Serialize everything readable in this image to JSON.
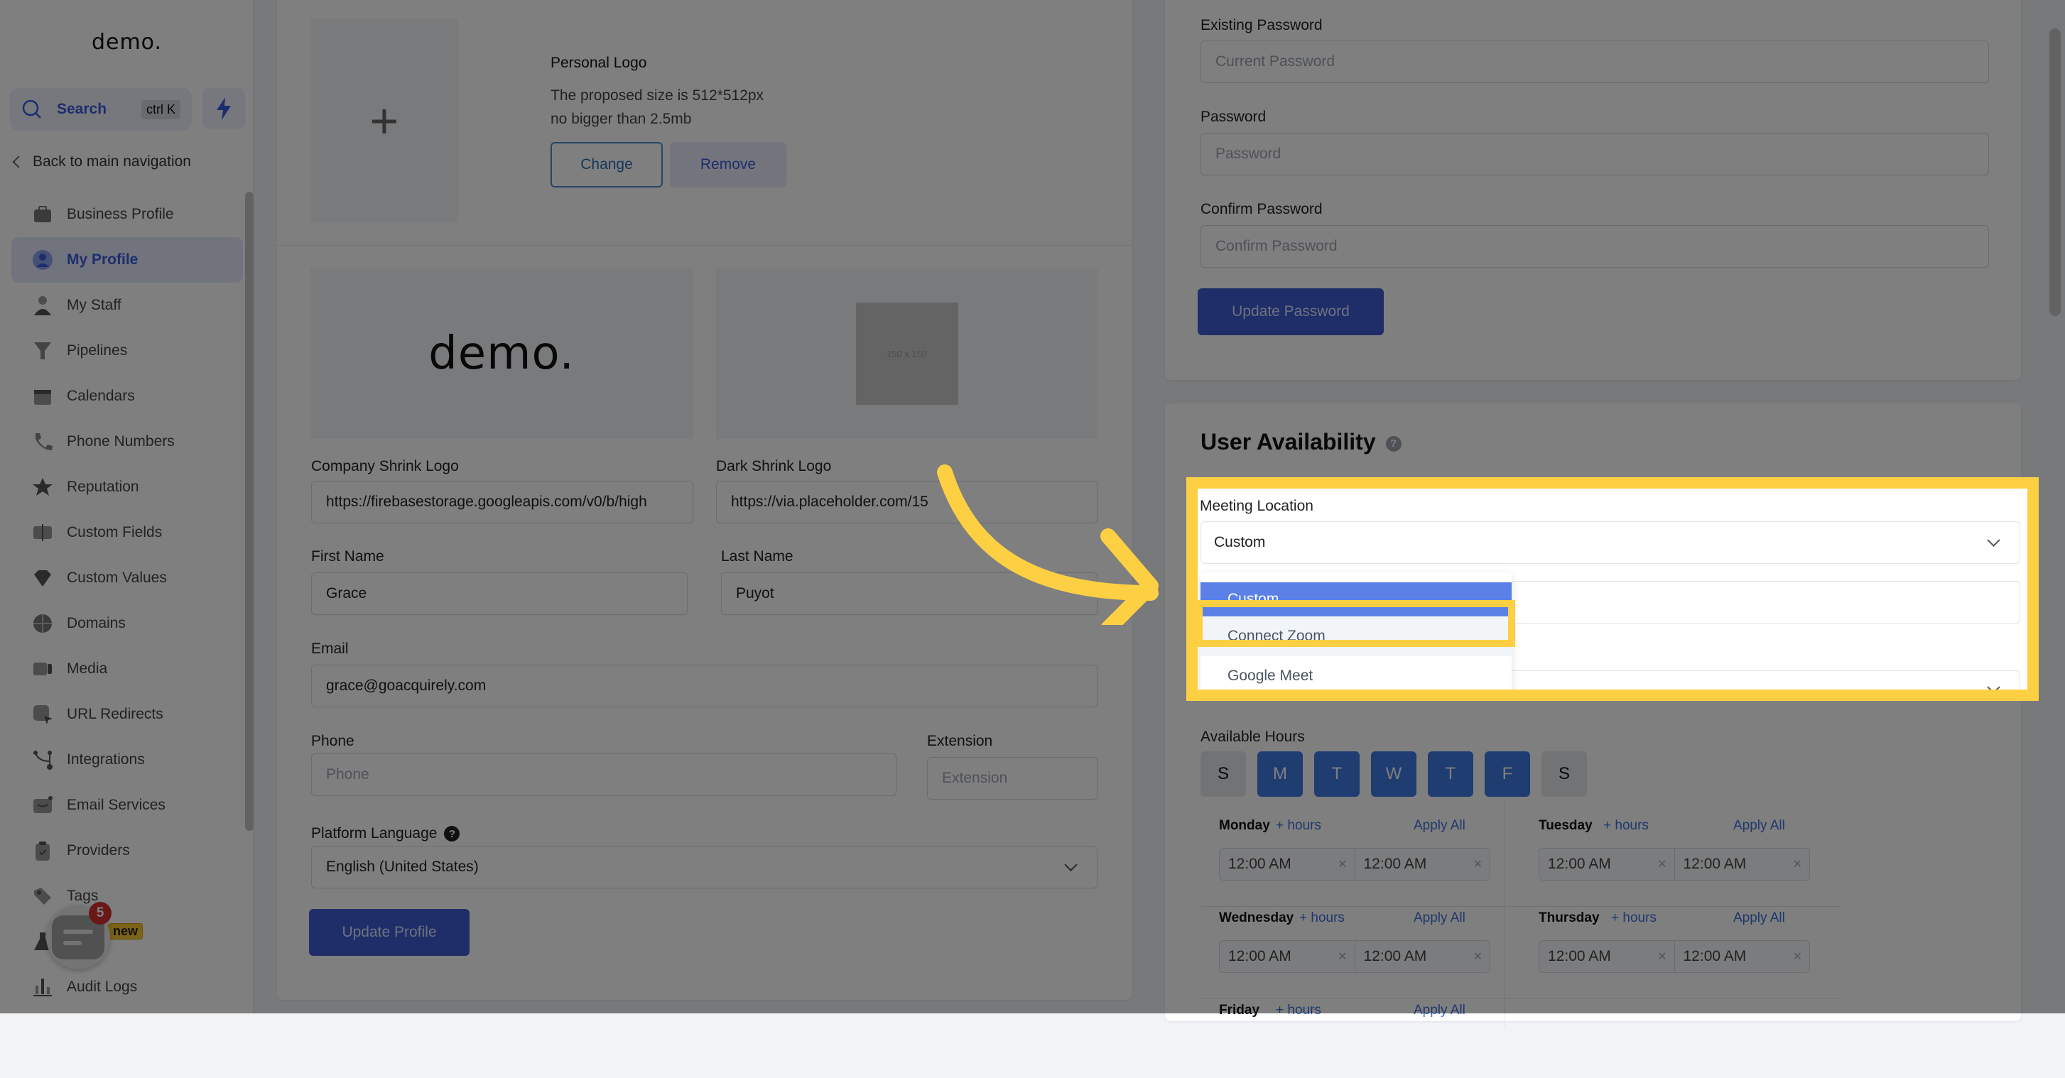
{
  "sidebar": {
    "logo": "demo.",
    "search_label": "Search",
    "search_shortcut": "ctrl K",
    "back_label": "Back to main navigation",
    "items": [
      {
        "label": "Business Profile",
        "icon": "briefcase-icon",
        "active": false
      },
      {
        "label": "My Profile",
        "icon": "user-circle-icon",
        "active": true
      },
      {
        "label": "My Staff",
        "icon": "person-icon",
        "active": false
      },
      {
        "label": "Pipelines",
        "icon": "funnel-icon",
        "active": false
      },
      {
        "label": "Calendars",
        "icon": "calendar-icon",
        "active": false
      },
      {
        "label": "Phone Numbers",
        "icon": "phone-icon",
        "active": false
      },
      {
        "label": "Reputation",
        "icon": "star-icon",
        "active": false
      },
      {
        "label": "Custom Fields",
        "icon": "text-field-icon",
        "active": false
      },
      {
        "label": "Custom Values",
        "icon": "gem-icon",
        "active": false
      },
      {
        "label": "Domains",
        "icon": "globe-icon",
        "active": false
      },
      {
        "label": "Media",
        "icon": "video-icon",
        "active": false
      },
      {
        "label": "URL Redirects",
        "icon": "redirect-icon",
        "active": false
      },
      {
        "label": "Integrations",
        "icon": "integrations-icon",
        "active": false
      },
      {
        "label": "Email Services",
        "icon": "email-icon",
        "active": false
      },
      {
        "label": "Providers",
        "icon": "clipboard-check-icon",
        "active": false
      },
      {
        "label": "Tags",
        "icon": "tag-icon",
        "active": false
      },
      {
        "label": "",
        "icon": "flask-icon",
        "active": false
      },
      {
        "label": "Audit Logs",
        "icon": "bar-chart-icon",
        "active": false
      }
    ],
    "chat_badge_count": "5",
    "new_badge": "new"
  },
  "profile": {
    "personal_logo_title": "Personal Logo",
    "personal_logo_desc_1": "The proposed size is 512*512px",
    "personal_logo_desc_2": "no bigger than 2.5mb",
    "change_label": "Change",
    "remove_label": "Remove",
    "company_logo_text": "demo.",
    "placeholder_img_text": "150 x 150",
    "company_shrink_logo_label": "Company Shrink Logo",
    "company_shrink_logo_value": "https://firebasestorage.googleapis.com/v0/b/high",
    "dark_shrink_logo_label": "Dark Shrink Logo",
    "dark_shrink_logo_value": "https://via.placeholder.com/15",
    "first_name_label": "First Name",
    "first_name_value": "Grace",
    "last_name_label": "Last Name",
    "last_name_value": "Puyot",
    "email_label": "Email",
    "email_value": "grace@goacquirely.com",
    "phone_label": "Phone",
    "phone_placeholder": "Phone",
    "extension_label": "Extension",
    "extension_placeholder": "Extension",
    "platform_language_label": "Platform Language",
    "platform_language_value": "English (United States)",
    "update_profile_label": "Update Profile"
  },
  "password": {
    "existing_label": "Existing Password",
    "existing_placeholder": "Current Password",
    "password_label": "Password",
    "password_placeholder": "Password",
    "confirm_label": "Confirm Password",
    "confirm_placeholder": "Confirm Password",
    "update_label": "Update Password"
  },
  "availability": {
    "title": "User Availability",
    "meeting_location_label": "Meeting Location",
    "meeting_location_value": "Custom",
    "dropdown_options": [
      "Custom",
      "Connect Zoom",
      "Google Meet"
    ],
    "dropdown_selected": "Custom",
    "dropdown_highlighted": "Connect Zoom",
    "available_hours_label": "Available Hours",
    "days": [
      {
        "letter": "S",
        "on": false
      },
      {
        "letter": "M",
        "on": true
      },
      {
        "letter": "T",
        "on": true
      },
      {
        "letter": "W",
        "on": true
      },
      {
        "letter": "T",
        "on": true
      },
      {
        "letter": "F",
        "on": true
      },
      {
        "letter": "S",
        "on": false
      }
    ],
    "add_hours_label": "+ hours",
    "apply_all_label": "Apply All",
    "schedule": [
      {
        "day": "Monday",
        "start": "12:00 AM",
        "end": "12:00 AM"
      },
      {
        "day": "Tuesday",
        "start": "12:00 AM",
        "end": "12:00 AM"
      },
      {
        "day": "Wednesday",
        "start": "12:00 AM",
        "end": "12:00 AM"
      },
      {
        "day": "Thursday",
        "start": "12:00 AM",
        "end": "12:00 AM"
      },
      {
        "day": "Friday",
        "start": "",
        "end": ""
      }
    ]
  },
  "colors": {
    "accent": "#3f5ad3",
    "day_on": "#3f7be0",
    "highlight": "#fdd043",
    "dropdown_selected": "#5b81e6"
  }
}
